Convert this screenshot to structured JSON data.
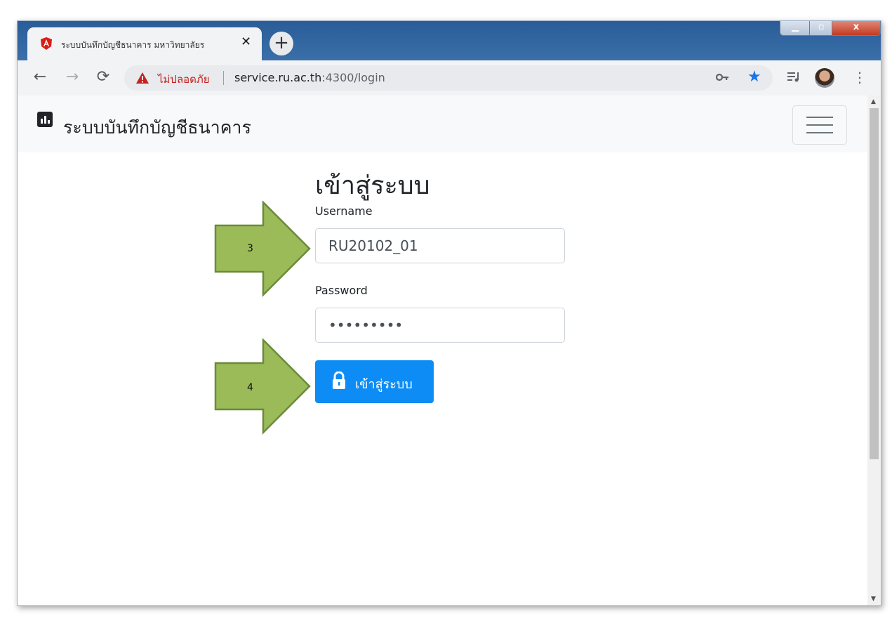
{
  "browser": {
    "tab_title": "ระบบบันทึกบัญชีธนาคาร มหาวิทยาลัยร",
    "tab_close": "✕",
    "new_tab": "+",
    "security_label": "ไม่ปลอดภัย",
    "url_host": "service.ru.ac.th",
    "url_rest": ":4300/login",
    "menu": "⋮",
    "star": "★"
  },
  "navbar": {
    "brand": "ระบบบันทึกบัญชีธนาคาร"
  },
  "login": {
    "title": "เข้าสู่ระบบ",
    "username_label": "Username",
    "username_value": "RU20102_01",
    "password_label": "Password",
    "password_value": "•••••••••",
    "submit_label": "เข้าสู่ระบบ"
  },
  "annotations": {
    "arrow_1": "3",
    "arrow_2": "4",
    "arrow_color": "#9bbb59"
  }
}
